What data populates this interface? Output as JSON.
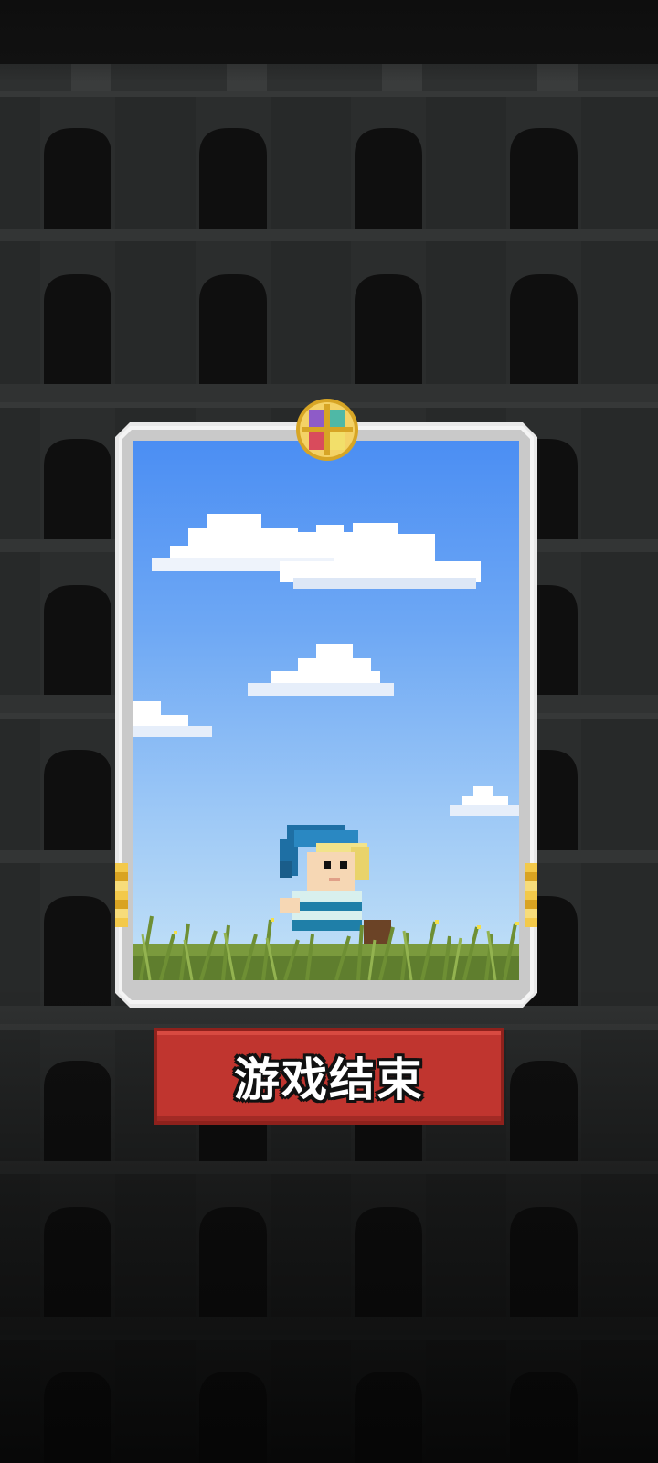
{
  "screen": "game-over",
  "game_over_button": {
    "label": "游戏结束"
  },
  "card": {
    "emblem": "four-color-emblem-icon",
    "scene": "sky-clouds-grass",
    "character": "blue-hat-child-character"
  },
  "colors": {
    "background": "#1a1b1b",
    "arch": "#2c2e2e",
    "sky_top": "#4b8ef3",
    "sky_bottom": "#c4e2f7",
    "grass": "#6f8f3a",
    "button": "#c0352f",
    "gold": "#f3c94a"
  }
}
